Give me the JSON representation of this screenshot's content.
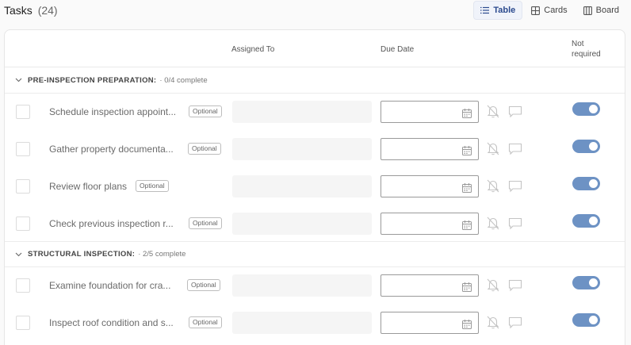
{
  "header": {
    "title": "Tasks",
    "count": "(24)"
  },
  "views": {
    "table": "Table",
    "cards": "Cards",
    "board": "Board"
  },
  "columns": {
    "assigned_to": "Assigned To",
    "due_date": "Due Date",
    "not_required": "Not\nrequired"
  },
  "groups": [
    {
      "name": "PRE-INSPECTION PREPARATION:",
      "progress": "· 0/4 complete",
      "tasks": [
        {
          "name": "Schedule inspection appoint...",
          "badge": "Optional",
          "not_required": true
        },
        {
          "name": "Gather property documenta...",
          "badge": "Optional",
          "not_required": true
        },
        {
          "name": "Review floor plans",
          "badge": "Optional",
          "not_required": true
        },
        {
          "name": "Check previous inspection r...",
          "badge": "Optional",
          "not_required": true
        }
      ]
    },
    {
      "name": "STRUCTURAL INSPECTION:",
      "progress": "· 2/5 complete",
      "tasks": [
        {
          "name": "Examine foundation for cra...",
          "badge": "Optional",
          "not_required": true
        },
        {
          "name": "Inspect roof condition and s...",
          "badge": "Optional",
          "not_required": true
        }
      ]
    }
  ],
  "colors": {
    "toggle_on": "#6d92c4",
    "active_view": "#2b4a8e"
  }
}
